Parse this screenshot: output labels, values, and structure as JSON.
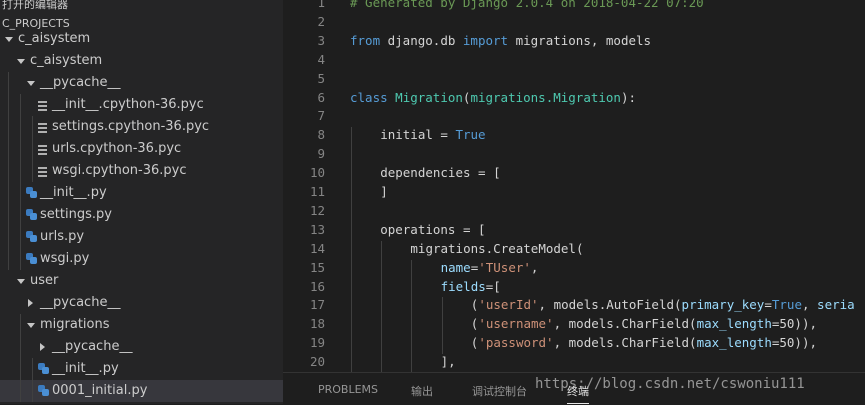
{
  "sidebar": {
    "open_editors_title": "打开的编辑器",
    "project_title": "C_PROJECTS",
    "tree": [
      {
        "label": "c_aisystem",
        "type": "folder",
        "state": "open",
        "depth": 0
      },
      {
        "label": "c_aisystem",
        "type": "folder",
        "state": "open",
        "depth": 1
      },
      {
        "label": "__pycache__",
        "type": "folder",
        "state": "open",
        "depth": 2
      },
      {
        "label": "__init__.cpython-36.pyc",
        "type": "pyc",
        "depth": 3
      },
      {
        "label": "settings.cpython-36.pyc",
        "type": "pyc",
        "depth": 3
      },
      {
        "label": "urls.cpython-36.pyc",
        "type": "pyc",
        "depth": 3
      },
      {
        "label": "wsgi.cpython-36.pyc",
        "type": "pyc",
        "depth": 3
      },
      {
        "label": "__init__.py",
        "type": "py",
        "depth": 2
      },
      {
        "label": "settings.py",
        "type": "py",
        "depth": 2
      },
      {
        "label": "urls.py",
        "type": "py",
        "depth": 2
      },
      {
        "label": "wsgi.py",
        "type": "py",
        "depth": 2
      },
      {
        "label": "user",
        "type": "folder",
        "state": "open",
        "depth": 1
      },
      {
        "label": "__pycache__",
        "type": "folder",
        "state": "closed",
        "depth": 2
      },
      {
        "label": "migrations",
        "type": "folder",
        "state": "open",
        "depth": 2
      },
      {
        "label": "__pycache__",
        "type": "folder",
        "state": "closed",
        "depth": 3
      },
      {
        "label": "__init__.py",
        "type": "py",
        "depth": 3
      },
      {
        "label": "0001_initial.py",
        "type": "py",
        "depth": 3,
        "selected": true
      }
    ]
  },
  "editor": {
    "lines": [
      {
        "n": "1",
        "indent": 0,
        "tokens": [
          [
            "c",
            "# Generated by Django 2.0.4 on 2018-04-22 07:20"
          ]
        ]
      },
      {
        "n": "2",
        "indent": 0,
        "tokens": []
      },
      {
        "n": "3",
        "indent": 0,
        "tokens": [
          [
            "k",
            "from"
          ],
          [
            "",
            " django.db "
          ],
          [
            "k",
            "import"
          ],
          [
            "",
            " migrations, models"
          ]
        ]
      },
      {
        "n": "4",
        "indent": 0,
        "tokens": []
      },
      {
        "n": "5",
        "indent": 0,
        "tokens": []
      },
      {
        "n": "6",
        "indent": 0,
        "tokens": [
          [
            "k",
            "class"
          ],
          [
            "",
            " "
          ],
          [
            "t",
            "Migration"
          ],
          [
            "",
            "("
          ],
          [
            "t",
            "migrations.Migration"
          ],
          [
            "",
            "):"
          ]
        ]
      },
      {
        "n": "7",
        "indent": 0,
        "tokens": []
      },
      {
        "n": "8",
        "indent": 1,
        "tokens": [
          [
            "",
            "initial = "
          ],
          [
            "k",
            "True"
          ]
        ]
      },
      {
        "n": "9",
        "indent": 0,
        "tokens": []
      },
      {
        "n": "10",
        "indent": 1,
        "tokens": [
          [
            "",
            "dependencies = ["
          ]
        ]
      },
      {
        "n": "11",
        "indent": 1,
        "tokens": [
          [
            "",
            "]"
          ]
        ]
      },
      {
        "n": "12",
        "indent": 0,
        "tokens": []
      },
      {
        "n": "13",
        "indent": 1,
        "tokens": [
          [
            "",
            "operations = ["
          ]
        ]
      },
      {
        "n": "14",
        "indent": 2,
        "tokens": [
          [
            "",
            "migrations.CreateModel("
          ]
        ]
      },
      {
        "n": "15",
        "indent": 3,
        "tokens": [
          [
            "p",
            "name"
          ],
          [
            "",
            "="
          ],
          [
            "s",
            "'TUser'"
          ],
          [
            "",
            ","
          ]
        ]
      },
      {
        "n": "16",
        "indent": 3,
        "tokens": [
          [
            "p",
            "fields"
          ],
          [
            "",
            "=["
          ]
        ]
      },
      {
        "n": "17",
        "indent": 4,
        "tokens": [
          [
            "",
            "("
          ],
          [
            "s",
            "'userId'"
          ],
          [
            "",
            ", models.AutoField("
          ],
          [
            "p",
            "primary_key"
          ],
          [
            "",
            "="
          ],
          [
            "k",
            "True"
          ],
          [
            "",
            ", "
          ],
          [
            "p",
            "seria"
          ]
        ]
      },
      {
        "n": "18",
        "indent": 4,
        "tokens": [
          [
            "",
            "("
          ],
          [
            "s",
            "'username'"
          ],
          [
            "",
            ", models.CharField("
          ],
          [
            "p",
            "max_length"
          ],
          [
            "",
            "=50)),"
          ]
        ]
      },
      {
        "n": "19",
        "indent": 4,
        "tokens": [
          [
            "",
            "("
          ],
          [
            "s",
            "'password'"
          ],
          [
            "",
            ", models.CharField("
          ],
          [
            "p",
            "max_length"
          ],
          [
            "",
            "=50)),"
          ]
        ]
      },
      {
        "n": "20",
        "indent": 3,
        "tokens": [
          [
            "",
            "],"
          ]
        ]
      }
    ]
  },
  "panel": {
    "tabs": [
      {
        "label": "PROBLEMS",
        "active": false
      },
      {
        "label": "输出",
        "active": false
      },
      {
        "label": "调试控制台",
        "active": false
      },
      {
        "label": "终端",
        "active": true
      }
    ],
    "watermark": "https://blog.csdn.net/cswoniu111"
  },
  "colors": {
    "sidebar_bg": "#252526",
    "editor_bg": "#1e1e1e",
    "keyword": "#569cd6",
    "comment": "#6a9955",
    "string": "#ce9178",
    "type": "#4ec9b0",
    "param": "#9cdcfe"
  },
  "icons": {
    "folder_open": "chevron-down-icon",
    "folder_closed": "chevron-right-icon",
    "pyc": "lines-file-icon",
    "py": "python-file-icon"
  }
}
